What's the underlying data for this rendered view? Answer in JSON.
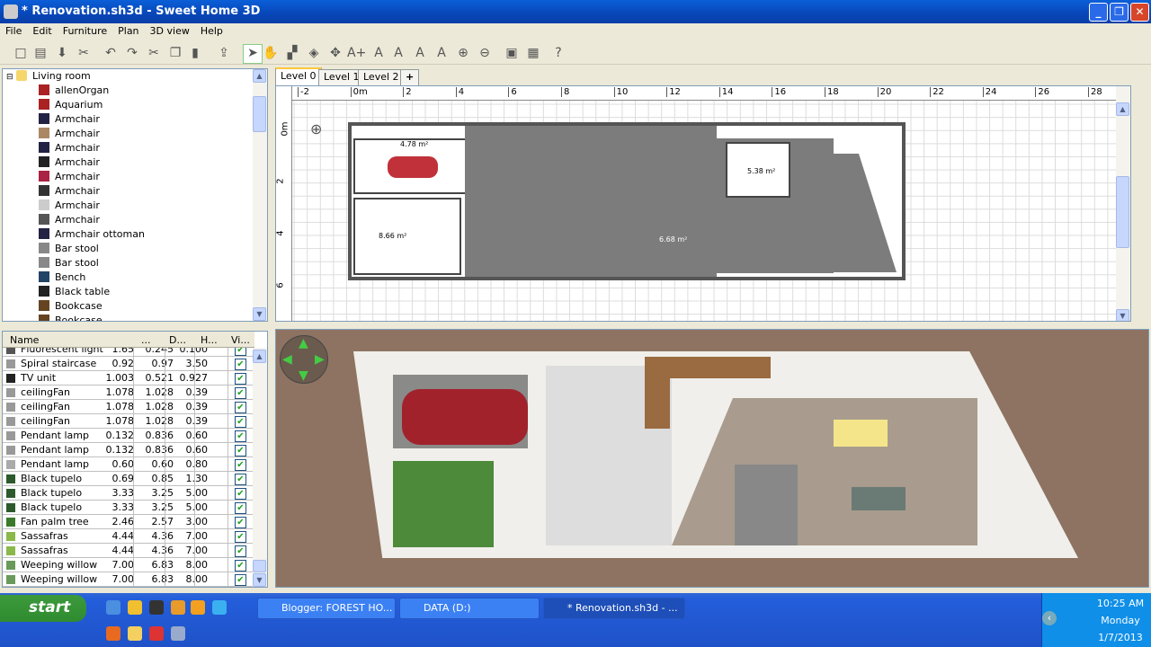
{
  "window": {
    "title": "* Renovation.sh3d - Sweet Home 3D",
    "controls": [
      "minimize",
      "maximize",
      "close"
    ]
  },
  "menu": [
    "File",
    "Edit",
    "Furniture",
    "Plan",
    "3D view",
    "Help"
  ],
  "toolbar": [
    "new-file-icon",
    "open-icon",
    "save-icon",
    "preferences-icon",
    "undo-icon",
    "redo-icon",
    "cut-icon",
    "copy-icon",
    "paste-icon",
    "add-furniture-icon",
    "select-icon",
    "pan-icon",
    "create-walls-icon",
    "create-rooms-icon",
    "create-dimensions-icon",
    "add-text-icon",
    "increase-text-icon",
    "decrease-text-icon",
    "bold-icon",
    "italic-icon",
    "zoom-in-icon",
    "zoom-out-icon",
    "create-photo-icon",
    "create-video-icon",
    "help-icon"
  ],
  "catalog": {
    "category": "Living room",
    "items": [
      "allenOrgan",
      "Aquarium",
      "Armchair",
      "Armchair",
      "Armchair",
      "Armchair",
      "Armchair",
      "Armchair",
      "Armchair",
      "Armchair",
      "Armchair ottoman",
      "Bar stool",
      "Bar stool",
      "Bench",
      "Black table",
      "Bookcase",
      "Bookcase"
    ]
  },
  "furniture_table": {
    "columns": [
      "Name",
      "...",
      "D...",
      "H...",
      "Vi..."
    ],
    "rows": [
      {
        "name": "Fluorescent light",
        "w": "1.65",
        "d": "0.245",
        "h": "0.100",
        "visible": true
      },
      {
        "name": "Spiral staircase",
        "w": "0.92",
        "d": "0.97",
        "h": "3.50",
        "visible": true
      },
      {
        "name": "TV unit",
        "w": "1.003",
        "d": "0.521",
        "h": "0.927",
        "visible": true
      },
      {
        "name": "ceilingFan",
        "w": "1.078",
        "d": "1.028",
        "h": "0.39",
        "visible": true
      },
      {
        "name": "ceilingFan",
        "w": "1.078",
        "d": "1.028",
        "h": "0.39",
        "visible": true
      },
      {
        "name": "ceilingFan",
        "w": "1.078",
        "d": "1.028",
        "h": "0.39",
        "visible": true
      },
      {
        "name": "Pendant lamp",
        "w": "0.132",
        "d": "0.836",
        "h": "0.60",
        "visible": true
      },
      {
        "name": "Pendant lamp",
        "w": "0.132",
        "d": "0.836",
        "h": "0.60",
        "visible": true
      },
      {
        "name": "Pendant lamp",
        "w": "0.60",
        "d": "0.60",
        "h": "0.80",
        "visible": true
      },
      {
        "name": "Black tupelo",
        "w": "0.69",
        "d": "0.85",
        "h": "1.30",
        "visible": true
      },
      {
        "name": "Black tupelo",
        "w": "3.33",
        "d": "3.25",
        "h": "5.00",
        "visible": true
      },
      {
        "name": "Black tupelo",
        "w": "3.33",
        "d": "3.25",
        "h": "5.00",
        "visible": true
      },
      {
        "name": "Fan palm tree",
        "w": "2.46",
        "d": "2.57",
        "h": "3.00",
        "visible": true
      },
      {
        "name": "Sassafras",
        "w": "4.44",
        "d": "4.36",
        "h": "7.00",
        "visible": true
      },
      {
        "name": "Sassafras",
        "w": "4.44",
        "d": "4.36",
        "h": "7.00",
        "visible": true
      },
      {
        "name": "Weeping willow",
        "w": "7.00",
        "d": "6.83",
        "h": "8.00",
        "visible": true
      },
      {
        "name": "Weeping willow",
        "w": "7.00",
        "d": "6.83",
        "h": "8.00",
        "visible": true
      }
    ]
  },
  "levels": [
    "Level 0",
    "Level 1",
    "Level 2"
  ],
  "add_level": "+",
  "plan": {
    "h_ruler": [
      "-2",
      "0m",
      "2",
      "4",
      "6",
      "8",
      "10",
      "12",
      "14",
      "16",
      "18",
      "20",
      "22",
      "24",
      "26",
      "28"
    ],
    "v_ruler": [
      "0m",
      "2",
      "4",
      "6"
    ],
    "room_labels": [
      "4.78 m²",
      "8.66 m²",
      "5.38 m²",
      "6.68 m²"
    ]
  },
  "taskbar": {
    "start": "start",
    "tasks": [
      {
        "label": "Blogger: FOREST HO...",
        "active": false
      },
      {
        "label": "DATA (D:)",
        "active": false
      },
      {
        "label": "* Renovation.sh3d - ...",
        "active": true
      }
    ],
    "clock": {
      "time": "10:25 AM",
      "day": "Monday",
      "date": "1/7/2013"
    }
  },
  "colors": {
    "titlebar": "#0a5fd8",
    "selected_tab": "#ffc83c",
    "ground_3d": "#8e7362",
    "taskbar": "#245edb",
    "tray": "#0f8fe8"
  }
}
